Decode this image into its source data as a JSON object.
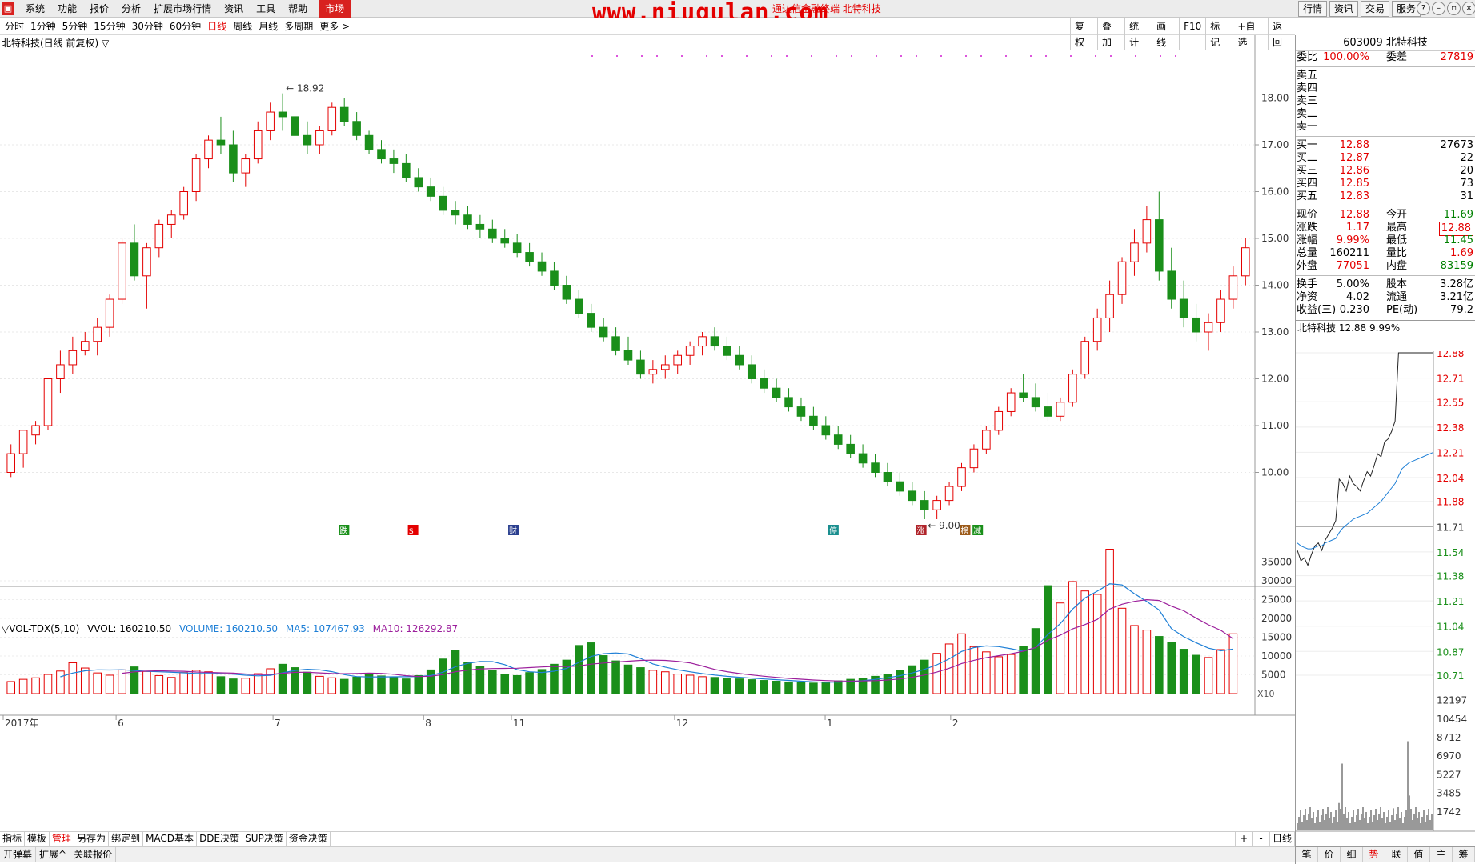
{
  "menu": {
    "items": [
      "系统",
      "功能",
      "报价",
      "分析",
      "扩展市场行情",
      "资讯",
      "工具",
      "帮助"
    ],
    "active": "市场"
  },
  "watermark": "www.niugulan.com",
  "window_title": "通达信金融终端  北特科技",
  "right_buttons": [
    "行情",
    "资讯",
    "交易",
    "服务"
  ],
  "periods": [
    "分时",
    "1分钟",
    "5分钟",
    "15分钟",
    "30分钟",
    "60分钟",
    "日线",
    "周线",
    "月线",
    "多周期",
    "更多 >"
  ],
  "selected_period": "日线",
  "chart_tools": [
    "复权",
    "叠加",
    "统计",
    "画线",
    "F10",
    "标记",
    "+自选",
    "返回"
  ],
  "chart_title": "北特科技(日线 前复权) ▽",
  "price_axis": [
    "18.00",
    "17.00",
    "16.00",
    "15.00",
    "14.00",
    "13.00",
    "12.00",
    "11.00",
    "10.00"
  ],
  "vol_axis": [
    "35000",
    "30000",
    "25000",
    "20000",
    "15000",
    "10000",
    "5000"
  ],
  "vol_unit": "X10",
  "date_labels": [
    "2017年",
    "6",
    "7",
    "8",
    "11",
    "12",
    "1",
    "2"
  ],
  "max_label": "18.92",
  "min_label": "9.00",
  "vol_header": {
    "name": "▽VOL-TDX(5,10)",
    "vvol": "VVOL: 160210.50",
    "volume": "VOLUME: 160210.50",
    "ma5": "MA5: 107467.93",
    "ma10": "MA10: 126292.87"
  },
  "colors": {
    "up": "#e40000",
    "down": "#1a8f1a",
    "ma5": "#1e7fd6",
    "ma10": "#9c1f9c"
  },
  "markers": [
    "跌",
    "$",
    "财",
    "停",
    "涨",
    "榜",
    "减"
  ],
  "chart_data": {
    "type": "candlestick",
    "ylim": [
      9.0,
      19.0
    ],
    "series": [
      {
        "name": "price",
        "values": [
          [
            10.0,
            10.6,
            9.9,
            10.4
          ],
          [
            10.4,
            10.9,
            10.1,
            10.9
          ],
          [
            10.8,
            11.1,
            10.6,
            11.0
          ],
          [
            11.0,
            12.0,
            10.9,
            12.0
          ],
          [
            12.0,
            12.6,
            11.7,
            12.3
          ],
          [
            12.3,
            12.9,
            12.1,
            12.6
          ],
          [
            12.6,
            13.0,
            12.5,
            12.8
          ],
          [
            12.8,
            13.3,
            12.5,
            13.1
          ],
          [
            13.1,
            13.8,
            12.9,
            13.7
          ],
          [
            13.7,
            15.0,
            13.6,
            14.9
          ],
          [
            14.9,
            15.3,
            14.1,
            14.2
          ],
          [
            14.2,
            14.9,
            13.5,
            14.8
          ],
          [
            14.8,
            15.4,
            14.6,
            15.3
          ],
          [
            15.3,
            15.6,
            15.0,
            15.5
          ],
          [
            15.5,
            16.1,
            15.4,
            16.0
          ],
          [
            16.0,
            16.8,
            15.8,
            16.7
          ],
          [
            16.7,
            17.2,
            16.5,
            17.1
          ],
          [
            17.1,
            17.6,
            16.8,
            17.0
          ],
          [
            17.0,
            17.3,
            16.2,
            16.4
          ],
          [
            16.4,
            16.8,
            16.1,
            16.7
          ],
          [
            16.7,
            17.5,
            16.6,
            17.3
          ],
          [
            17.3,
            17.9,
            17.1,
            17.7
          ],
          [
            17.7,
            18.1,
            17.3,
            17.6
          ],
          [
            17.6,
            17.8,
            17.0,
            17.2
          ],
          [
            17.2,
            17.5,
            16.8,
            17.0
          ],
          [
            17.0,
            17.4,
            16.8,
            17.3
          ],
          [
            17.3,
            17.9,
            17.2,
            17.8
          ],
          [
            17.8,
            18.0,
            17.4,
            17.5
          ],
          [
            17.5,
            17.7,
            17.1,
            17.2
          ],
          [
            17.2,
            17.3,
            16.8,
            16.9
          ],
          [
            16.9,
            17.1,
            16.6,
            16.7
          ],
          [
            16.7,
            16.9,
            16.4,
            16.6
          ],
          [
            16.6,
            16.8,
            16.2,
            16.3
          ],
          [
            16.3,
            16.5,
            16.0,
            16.1
          ],
          [
            16.1,
            16.3,
            15.8,
            15.9
          ],
          [
            15.9,
            16.1,
            15.5,
            15.6
          ],
          [
            15.6,
            15.8,
            15.3,
            15.5
          ],
          [
            15.5,
            15.7,
            15.2,
            15.3
          ],
          [
            15.3,
            15.5,
            15.0,
            15.2
          ],
          [
            15.2,
            15.4,
            14.9,
            15.0
          ],
          [
            15.0,
            15.2,
            14.8,
            14.9
          ],
          [
            14.9,
            15.1,
            14.6,
            14.7
          ],
          [
            14.7,
            14.9,
            14.4,
            14.5
          ],
          [
            14.5,
            14.7,
            14.2,
            14.3
          ],
          [
            14.3,
            14.5,
            13.9,
            14.0
          ],
          [
            14.0,
            14.2,
            13.6,
            13.7
          ],
          [
            13.7,
            13.9,
            13.3,
            13.4
          ],
          [
            13.4,
            13.6,
            13.0,
            13.1
          ],
          [
            13.1,
            13.3,
            12.8,
            12.9
          ],
          [
            12.9,
            13.1,
            12.5,
            12.6
          ],
          [
            12.6,
            12.9,
            12.3,
            12.4
          ],
          [
            12.4,
            12.6,
            12.0,
            12.1
          ],
          [
            12.1,
            12.4,
            11.9,
            12.2
          ],
          [
            12.2,
            12.5,
            12.0,
            12.3
          ],
          [
            12.3,
            12.6,
            12.1,
            12.5
          ],
          [
            12.5,
            12.8,
            12.3,
            12.7
          ],
          [
            12.7,
            13.0,
            12.5,
            12.9
          ],
          [
            12.9,
            13.1,
            12.6,
            12.7
          ],
          [
            12.7,
            12.9,
            12.4,
            12.5
          ],
          [
            12.5,
            12.7,
            12.2,
            12.3
          ],
          [
            12.3,
            12.5,
            11.9,
            12.0
          ],
          [
            12.0,
            12.2,
            11.7,
            11.8
          ],
          [
            11.8,
            12.0,
            11.5,
            11.6
          ],
          [
            11.6,
            11.8,
            11.3,
            11.4
          ],
          [
            11.4,
            11.6,
            11.1,
            11.2
          ],
          [
            11.2,
            11.4,
            10.9,
            11.0
          ],
          [
            11.0,
            11.2,
            10.7,
            10.8
          ],
          [
            10.8,
            11.0,
            10.5,
            10.6
          ],
          [
            10.6,
            10.8,
            10.3,
            10.4
          ],
          [
            10.4,
            10.6,
            10.1,
            10.2
          ],
          [
            10.2,
            10.4,
            9.9,
            10.0
          ],
          [
            10.0,
            10.2,
            9.7,
            9.8
          ],
          [
            9.8,
            10.0,
            9.5,
            9.6
          ],
          [
            9.6,
            9.8,
            9.3,
            9.4
          ],
          [
            9.4,
            9.6,
            9.0,
            9.2
          ],
          [
            9.2,
            9.5,
            9.0,
            9.4
          ],
          [
            9.4,
            9.8,
            9.3,
            9.7
          ],
          [
            9.7,
            10.2,
            9.6,
            10.1
          ],
          [
            10.1,
            10.6,
            10.0,
            10.5
          ],
          [
            10.5,
            11.0,
            10.4,
            10.9
          ],
          [
            10.9,
            11.4,
            10.8,
            11.3
          ],
          [
            11.3,
            11.8,
            11.2,
            11.7
          ],
          [
            11.7,
            12.1,
            11.5,
            11.6
          ],
          [
            11.6,
            11.9,
            11.3,
            11.4
          ],
          [
            11.4,
            11.7,
            11.1,
            11.2
          ],
          [
            11.2,
            11.6,
            11.1,
            11.5
          ],
          [
            11.5,
            12.2,
            11.4,
            12.1
          ],
          [
            12.1,
            12.9,
            12.0,
            12.8
          ],
          [
            12.8,
            13.5,
            12.6,
            13.3
          ],
          [
            13.3,
            14.1,
            13.0,
            13.8
          ],
          [
            13.8,
            14.6,
            13.6,
            14.5
          ],
          [
            14.5,
            15.2,
            14.2,
            14.9
          ],
          [
            14.9,
            15.7,
            14.7,
            15.4
          ],
          [
            15.4,
            16.0,
            14.1,
            14.3
          ],
          [
            14.3,
            14.8,
            13.5,
            13.7
          ],
          [
            13.7,
            14.1,
            13.1,
            13.3
          ],
          [
            13.3,
            13.6,
            12.8,
            13.0
          ],
          [
            13.0,
            13.4,
            12.6,
            13.2
          ],
          [
            13.2,
            13.9,
            13.0,
            13.7
          ],
          [
            13.7,
            14.4,
            13.5,
            14.2
          ],
          [
            14.2,
            15.0,
            14.0,
            14.8
          ]
        ]
      }
    ],
    "volume": [
      3200,
      3800,
      4200,
      5100,
      6000,
      8200,
      6800,
      5500,
      4900,
      6300,
      7100,
      5900,
      4800,
      4300,
      5600,
      6200,
      5800,
      4500,
      3900,
      4100,
      5300,
      6600,
      7800,
      6900,
      5700,
      4600,
      4200,
      3800,
      4400,
      5100,
      4700,
      4300,
      3900,
      4800,
      6300,
      9200,
      11500,
      8400,
      7300,
      6100,
      5200,
      4800,
      5600,
      6400,
      7800,
      8900,
      12800,
      13500,
      10100,
      8700,
      7600,
      6900,
      6200,
      5800,
      5200,
      4900,
      4500,
      4300,
      4100,
      3900,
      3700,
      3500,
      3300,
      3100,
      2900,
      2800,
      3000,
      3400,
      3800,
      4100,
      4600,
      5200,
      6100,
      7400,
      8900,
      10700,
      13200,
      15900,
      12500,
      11100,
      9800,
      10400,
      12600,
      17300,
      28700,
      24100,
      29800,
      27300,
      26400,
      38400,
      22700,
      18100,
      16900,
      15200,
      13600,
      11800,
      10200,
      9600,
      11700,
      15900
    ]
  },
  "right_panel": {
    "code": "603009",
    "name": "北特科技",
    "weibi_label": "委比",
    "weibi": "100.00%",
    "weicha_label": "委差",
    "weicha": "27819",
    "sells": [
      "卖五",
      "卖四",
      "卖三",
      "卖二",
      "卖一"
    ],
    "buys": [
      {
        "l": "买一",
        "p": "12.88",
        "v": "27673"
      },
      {
        "l": "买二",
        "p": "12.87",
        "v": "22"
      },
      {
        "l": "买三",
        "p": "12.86",
        "v": "20"
      },
      {
        "l": "买四",
        "p": "12.85",
        "v": "73"
      },
      {
        "l": "买五",
        "p": "12.83",
        "v": "31"
      }
    ],
    "stats": [
      {
        "l1": "现价",
        "v1": "12.88",
        "l2": "今开",
        "v2": "11.69"
      },
      {
        "l1": "涨跌",
        "v1": "1.17",
        "l2": "最高",
        "v2": "12.88"
      },
      {
        "l1": "涨幅",
        "v1": "9.99%",
        "l2": "最低",
        "v2": "11.45"
      },
      {
        "l1": "总量",
        "v1": "160211",
        "l2": "量比",
        "v2": "1.69"
      },
      {
        "l1": "外盘",
        "v1": "77051",
        "l2": "内盘",
        "v2": "83159"
      }
    ],
    "stats2": [
      {
        "l1": "换手",
        "v1": "5.00%",
        "l2": "股本",
        "v2": "3.28亿"
      },
      {
        "l1": "净资",
        "v1": "4.02",
        "l2": "流通",
        "v2": "3.21亿"
      },
      {
        "l1": "收益(三)",
        "v1": "0.230",
        "l2": "PE(动)",
        "v2": "79.2"
      }
    ],
    "mini_header": "北特科技  12.88  9.99%",
    "mini_price_axis": [
      "12.88",
      "12.71",
      "12.55",
      "12.38",
      "12.21",
      "12.04",
      "11.88",
      "11.71",
      "11.54",
      "11.38",
      "11.21",
      "11.04",
      "10.87",
      "10.71"
    ],
    "mini_vol_axis": [
      "12197",
      "10454",
      "8712",
      "6970",
      "5227",
      "3485",
      "1742"
    ],
    "tabs": [
      "笔",
      "价",
      "细",
      "势",
      "联",
      "值",
      "主",
      "筹"
    ],
    "selected_tab": "势"
  },
  "bottom_tabs": [
    "指标",
    "模板",
    "管理",
    "另存为",
    "绑定到",
    "MACD基本",
    "DDE决策",
    "SUP决策",
    "资金决策"
  ],
  "selected_bottom_tab": "管理",
  "bottom_right": [
    "+",
    "-",
    "日线"
  ],
  "status_items": [
    "开弹幕",
    "扩展^",
    "关联报价"
  ]
}
